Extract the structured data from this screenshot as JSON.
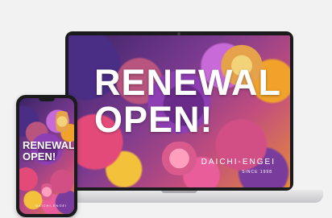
{
  "laptop": {
    "headline_line1": "RENEWAL",
    "headline_line2": "OPEN!",
    "brand": "DAICHI-ENGEI",
    "since": "SINCE 1998"
  },
  "phone": {
    "headline_line1": "RENEWAL",
    "headline_line2": "OPEN!",
    "brand": "DAICHI-ENGEI"
  }
}
